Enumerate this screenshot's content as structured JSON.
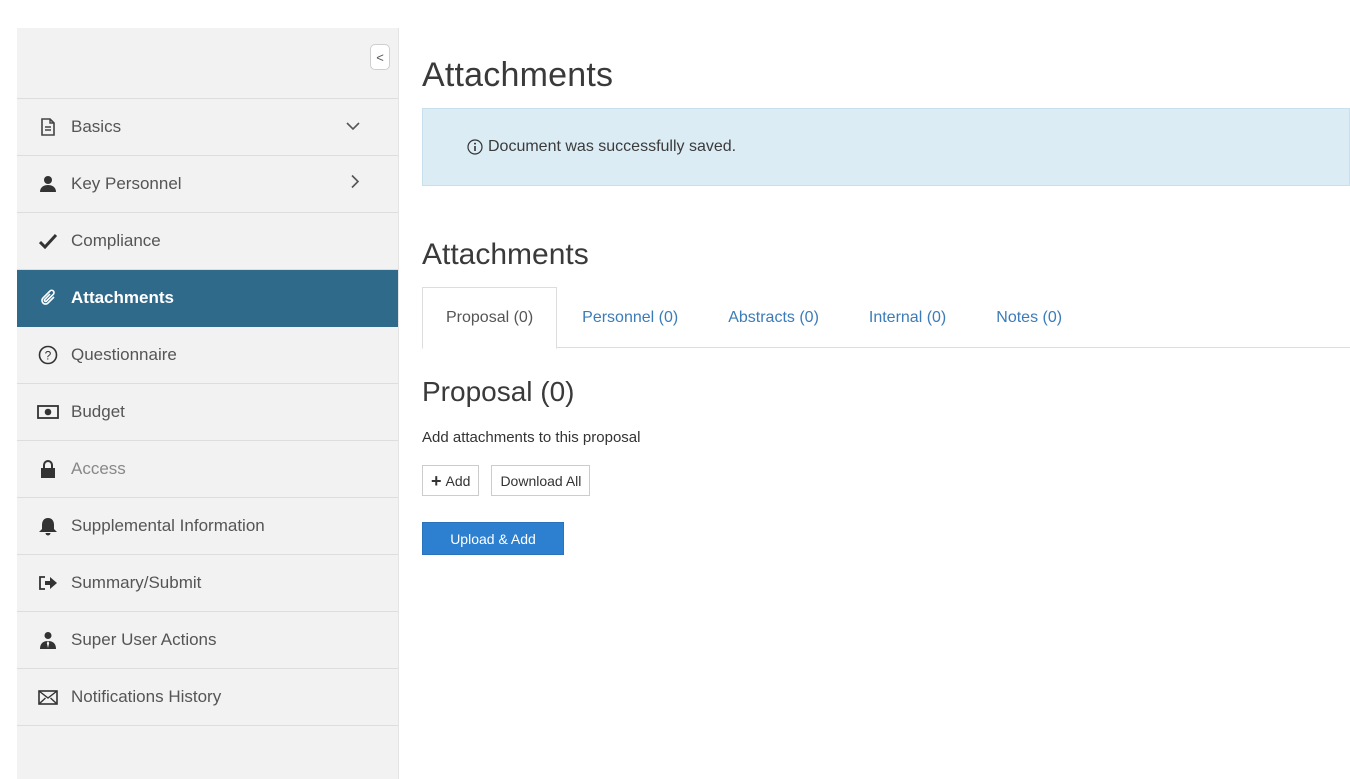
{
  "sidebar": {
    "collapse_label": "<",
    "items": [
      {
        "label": "Basics",
        "icon": "document-icon",
        "chevron": "⌄"
      },
      {
        "label": "Key Personnel",
        "icon": "user-icon",
        "chevron": ">"
      },
      {
        "label": "Compliance",
        "icon": "check-icon"
      },
      {
        "label": "Attachments",
        "icon": "paperclip-icon",
        "active": true
      },
      {
        "label": "Questionnaire",
        "icon": "question-circle-icon"
      },
      {
        "label": "Budget",
        "icon": "money-icon"
      },
      {
        "label": "Access",
        "icon": "lock-icon"
      },
      {
        "label": "Supplemental Information",
        "icon": "bell-icon"
      },
      {
        "label": "Summary/Submit",
        "icon": "submit-icon"
      },
      {
        "label": "Super User Actions",
        "icon": "super-user-icon"
      },
      {
        "label": "Notifications History",
        "icon": "envelope-icon"
      }
    ]
  },
  "main": {
    "page_title": "Attachments",
    "alert": {
      "icon": "info-icon",
      "message": "Document was successfully saved."
    },
    "section_title": "Attachments",
    "tabs": [
      {
        "label": "Proposal (0)",
        "active": true
      },
      {
        "label": "Personnel (0)"
      },
      {
        "label": "Abstracts (0)"
      },
      {
        "label": "Internal (0)"
      },
      {
        "label": "Notes (0)"
      }
    ],
    "sub_title": "Proposal (0)",
    "description": "Add attachments to this proposal",
    "add_button": {
      "icon": "plus-icon",
      "label": "Add"
    },
    "download_all_label": "Download All",
    "upload_label": "Upload & Add"
  },
  "colors": {
    "sidebar_bg": "#f2f2f2",
    "active_item": "#2f6a8a",
    "alert_bg": "#dcecf5",
    "link": "#3b7cb8",
    "primary_button": "#2d7fcf"
  }
}
